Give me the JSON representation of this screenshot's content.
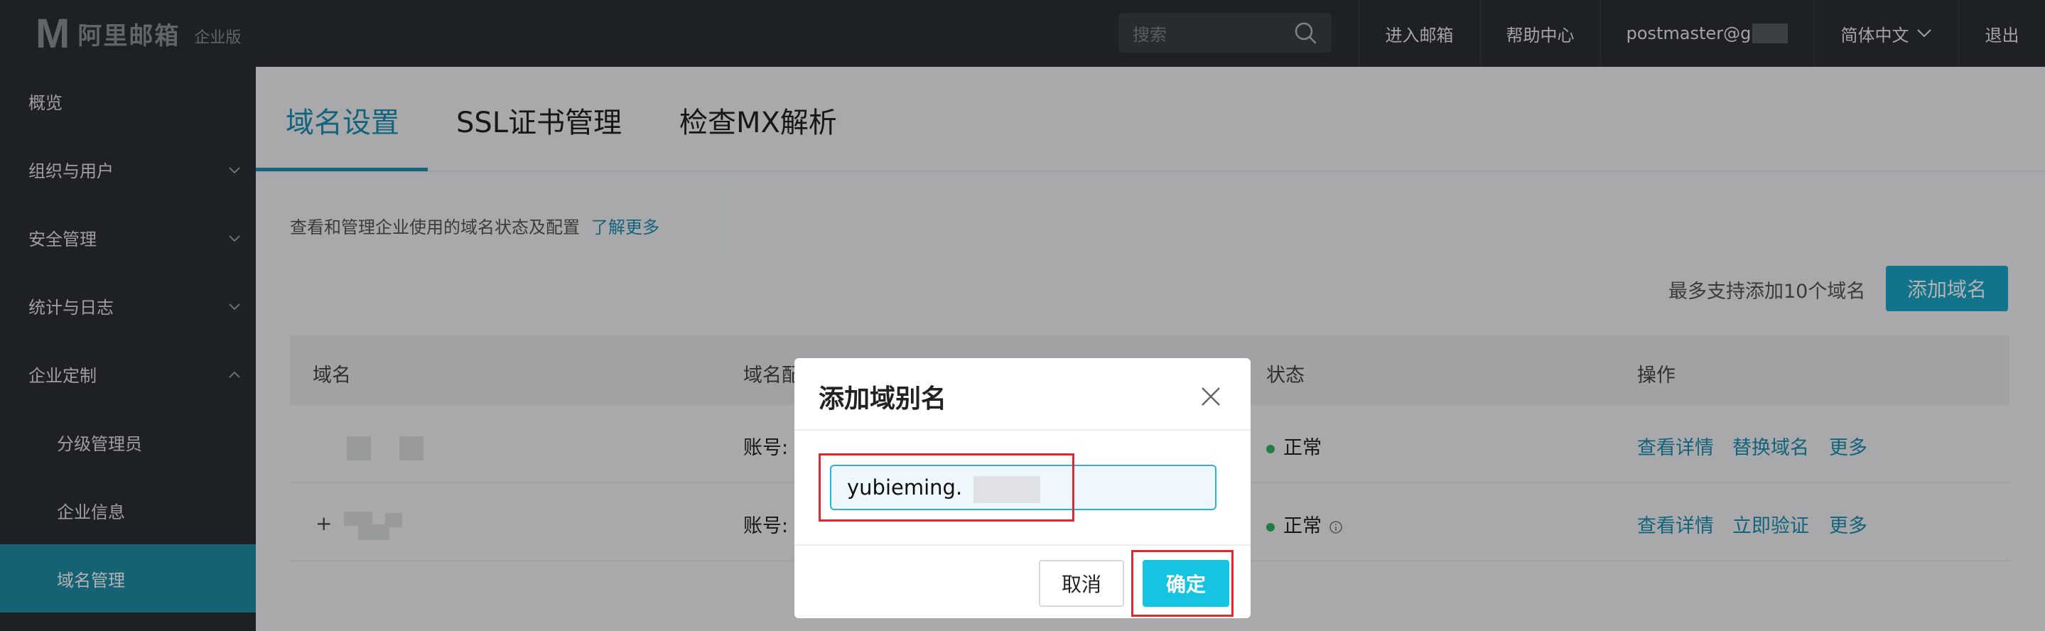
{
  "app": {
    "logo_mark": "M",
    "logo_text": "阿里邮箱",
    "logo_edition": "企业版"
  },
  "header": {
    "search_placeholder": "搜索",
    "nav": {
      "enter_mail": "进入邮箱",
      "help_center": "帮助中心",
      "user": "postmaster@g",
      "language": "简体中文",
      "logout": "退出"
    }
  },
  "sidebar": {
    "items": [
      {
        "label": "概览"
      },
      {
        "label": "组织与用户"
      },
      {
        "label": "安全管理"
      },
      {
        "label": "统计与日志"
      },
      {
        "label": "企业定制"
      },
      {
        "label": "分级管理员"
      },
      {
        "label": "企业信息"
      },
      {
        "label": "域名管理"
      }
    ]
  },
  "main": {
    "tabs": [
      {
        "label": "域名设置"
      },
      {
        "label": "SSL证书管理"
      },
      {
        "label": "检查MX解析"
      }
    ],
    "description": "查看和管理企业使用的域名状态及配置",
    "learn_more": "了解更多",
    "limit_text": "最多支持添加10个域名",
    "add_domain_button": "添加域名",
    "table": {
      "headers": [
        "域名",
        "域名配置",
        "状态",
        "操作"
      ],
      "rows": [
        {
          "config": "账号:",
          "status": "正常",
          "actions": [
            "查看详情",
            "替换域名",
            "更多"
          ]
        },
        {
          "expand": "+",
          "config": "账号:",
          "status": "正常",
          "actions": [
            "查看详情",
            "立即验证",
            "更多"
          ]
        }
      ]
    }
  },
  "modal": {
    "title": "添加域别名",
    "input_value": "yubieming.",
    "cancel": "取消",
    "confirm": "确定"
  },
  "colors": {
    "accent": "#1b8fb0",
    "primary_button": "#14c4e0",
    "highlight": "#e0282e",
    "status_ok": "#2db55d"
  }
}
